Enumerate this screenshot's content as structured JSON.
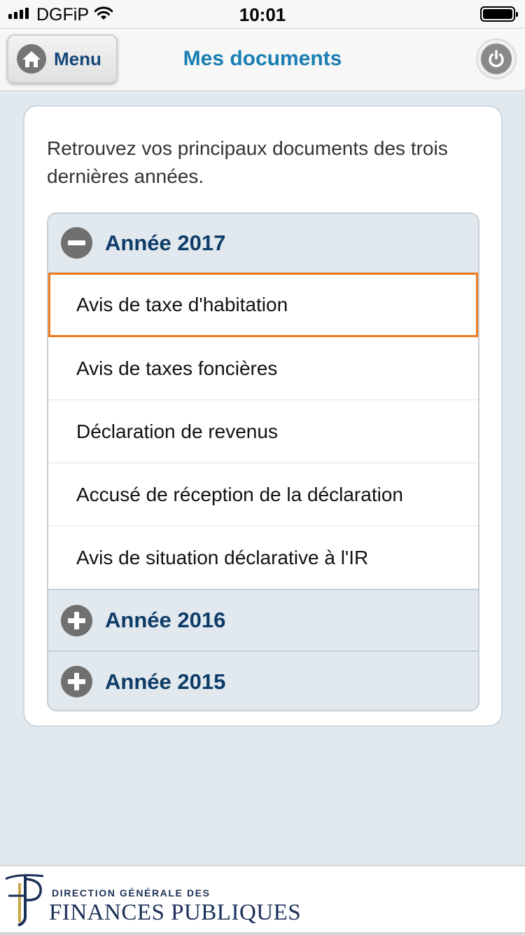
{
  "status_bar": {
    "carrier": "DGFiP",
    "time": "10:01",
    "icons": [
      "signal-icon",
      "wifi-icon",
      "battery-icon"
    ]
  },
  "header": {
    "menu_label": "Menu",
    "title": "Mes documents",
    "icons": {
      "menu": "home-icon",
      "logout": "power-icon"
    }
  },
  "main": {
    "intro": "Retrouvez vos principaux documents des trois dernières années.",
    "years": [
      {
        "label": "Année 2017",
        "expanded": true,
        "documents": [
          "Avis de taxe d'habitation",
          "Avis de taxes foncières",
          "Déclaration de revenus",
          "Accusé de réception de la déclaration",
          "Avis de situation déclarative à l'IR"
        ]
      },
      {
        "label": "Année 2016",
        "expanded": false
      },
      {
        "label": "Année 2015",
        "expanded": false
      }
    ],
    "selected_document": "Avis de taxe d'habitation"
  },
  "footer": {
    "logo_line1": "DIRECTION GÉNÉRALE DES",
    "logo_line2": "FINANCES PUBLIQUES"
  },
  "colors": {
    "title_blue": "#1a7eb3",
    "year_navy": "#0e3c68",
    "selection_orange": "#f07a1e",
    "background": "#e1e8ee"
  }
}
